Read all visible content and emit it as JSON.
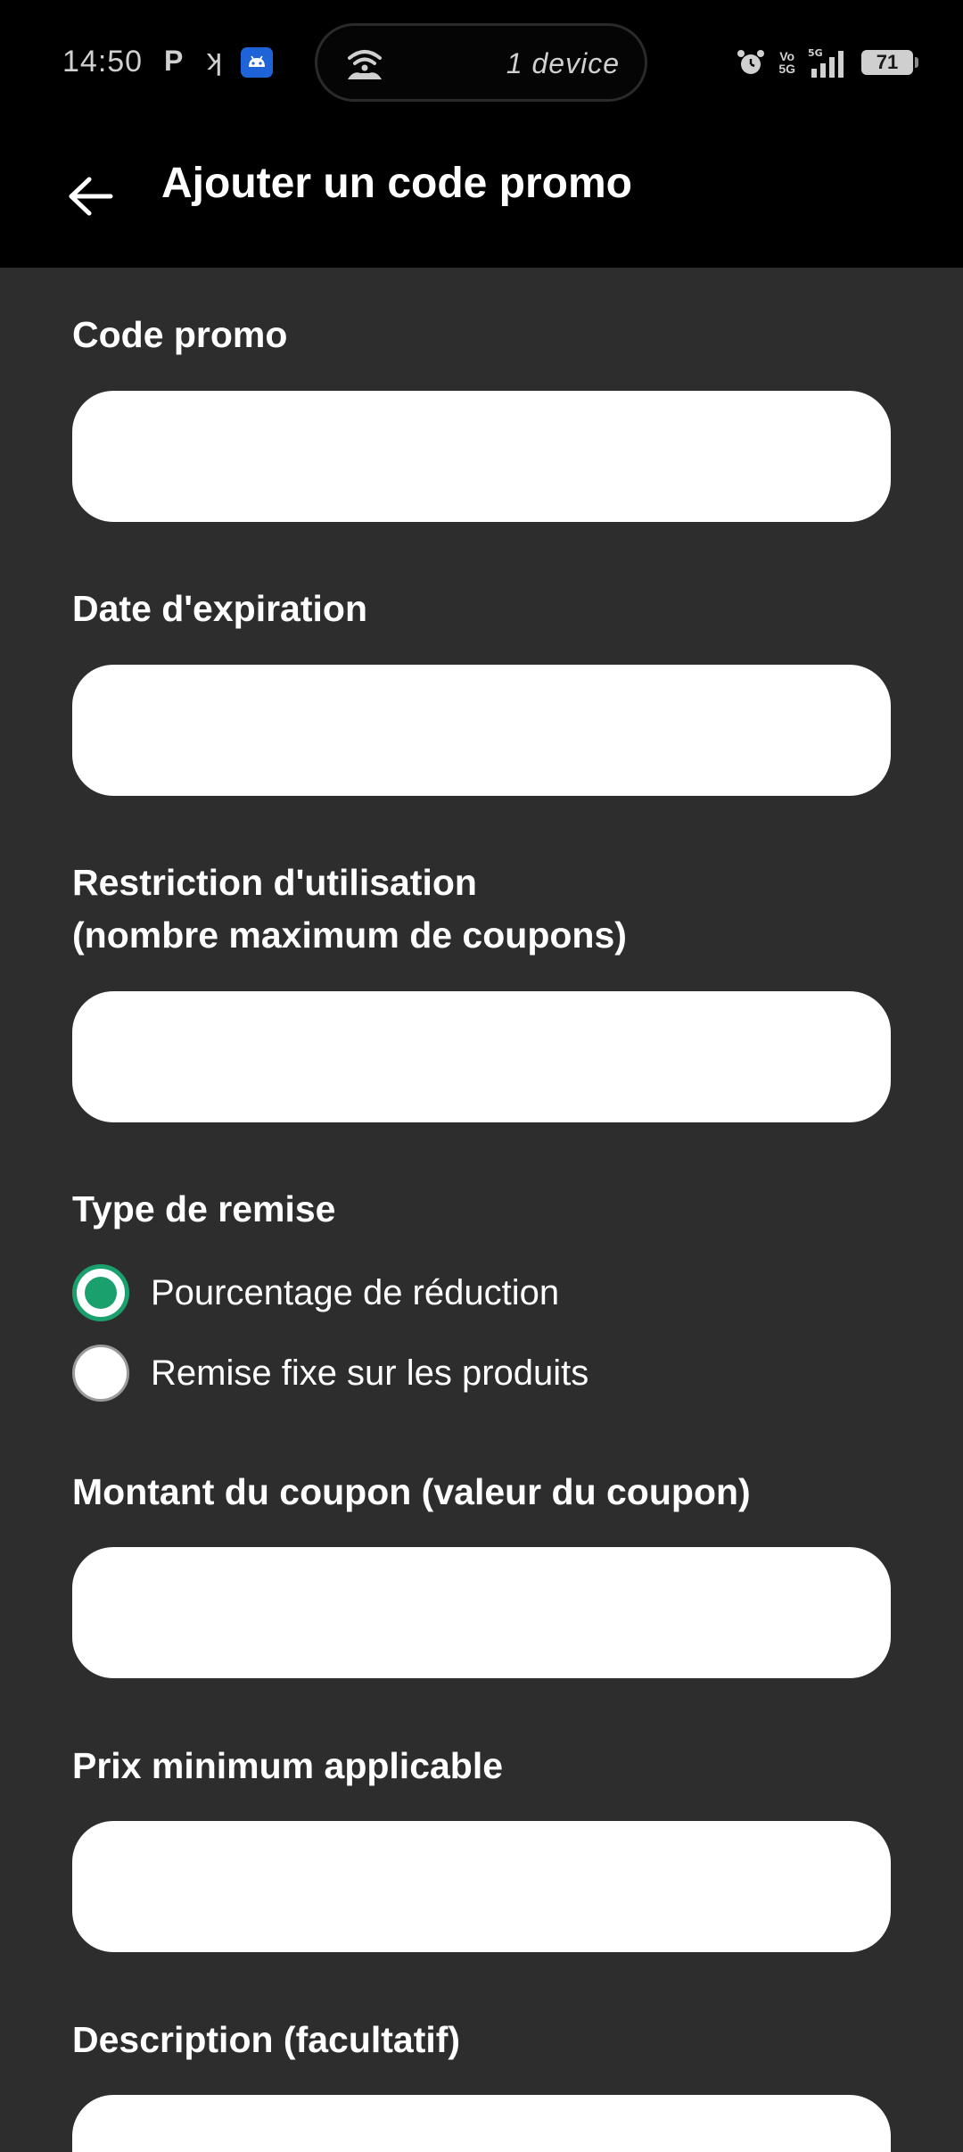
{
  "status_bar": {
    "time": "14:50",
    "app_p": "P",
    "app_k": "ʞ",
    "hotspot_text": "1 device",
    "volte_top": "Vo",
    "volte_bottom": "5G",
    "network_type": "5G",
    "battery_level": "71"
  },
  "header": {
    "title": "Ajouter un code promo"
  },
  "form": {
    "promo_code": {
      "label": "Code promo",
      "value": ""
    },
    "expiration_date": {
      "label": "Date d'expiration",
      "value": ""
    },
    "usage_restriction": {
      "label_line1": "Restriction d'utilisation",
      "label_line2": "(nombre maximum de coupons)",
      "value": ""
    },
    "discount_type": {
      "label": "Type de remise",
      "options": [
        {
          "label": "Pourcentage de réduction",
          "selected": true
        },
        {
          "label": "Remise fixe sur les produits",
          "selected": false
        }
      ]
    },
    "coupon_amount": {
      "label": "Montant du coupon (valeur du coupon)",
      "value": ""
    },
    "minimum_price": {
      "label": "Prix minimum applicable",
      "value": ""
    },
    "description": {
      "label": "Description (facultatif)",
      "value": ""
    }
  },
  "colors": {
    "background": "#2d2d2d",
    "header": "#000000",
    "input": "#ffffff",
    "accent": "#1aa06d"
  }
}
